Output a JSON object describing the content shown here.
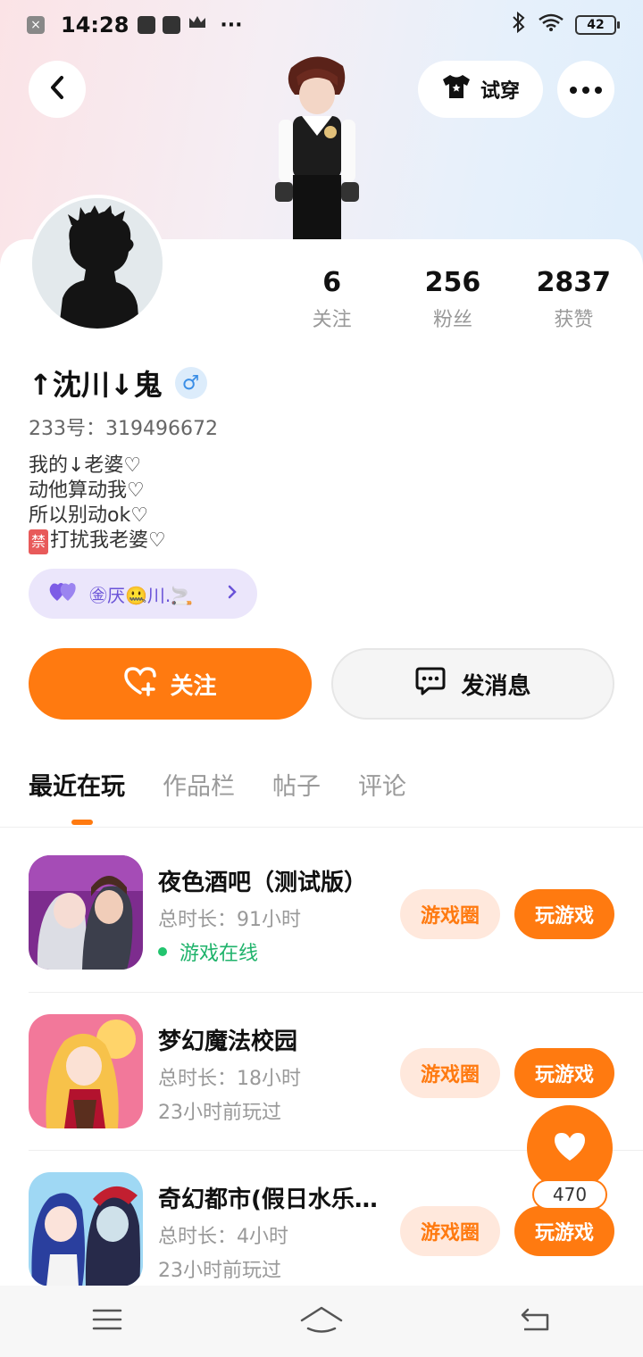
{
  "status_bar": {
    "time": "14:28",
    "more": "···",
    "battery": "42"
  },
  "header": {
    "try_on_label": "试穿"
  },
  "profile": {
    "stats": [
      {
        "value": "6",
        "label": "关注"
      },
      {
        "value": "256",
        "label": "粉丝"
      },
      {
        "value": "2837",
        "label": "获赞"
      }
    ],
    "username": "↑沈川↓鬼",
    "gender_symbol": "♂",
    "uid": "233号：319496672",
    "bio": [
      "我的↓老婆♡",
      "动他算动我♡",
      "所以别动ok♡",
      "打扰我老婆♡"
    ],
    "bio_tag": "禁",
    "cp_name": "㊎厌🤐川.🚬"
  },
  "actions": {
    "follow_label": "关注",
    "message_label": "发消息"
  },
  "tabs": [
    "最近在玩",
    "作品栏",
    "帖子",
    "评论"
  ],
  "games": [
    {
      "title": "夜色酒吧（测试版）",
      "duration": "总时长：91小时",
      "status": "游戏在线",
      "online": true
    },
    {
      "title": "梦幻魔法校园",
      "duration": "总时长：18小时",
      "status": "23小时前玩过",
      "online": false
    },
    {
      "title": "奇幻都市(假日水乐…",
      "duration": "总时长：4小时",
      "status": "23小时前玩过",
      "online": false
    }
  ],
  "game_buttons": {
    "circle_label": "游戏圈",
    "play_label": "玩游戏"
  },
  "like_count": "470",
  "colors": {
    "accent": "#ff7a10",
    "online": "#1fb36b",
    "cp_pill": "#ebe6fb"
  }
}
